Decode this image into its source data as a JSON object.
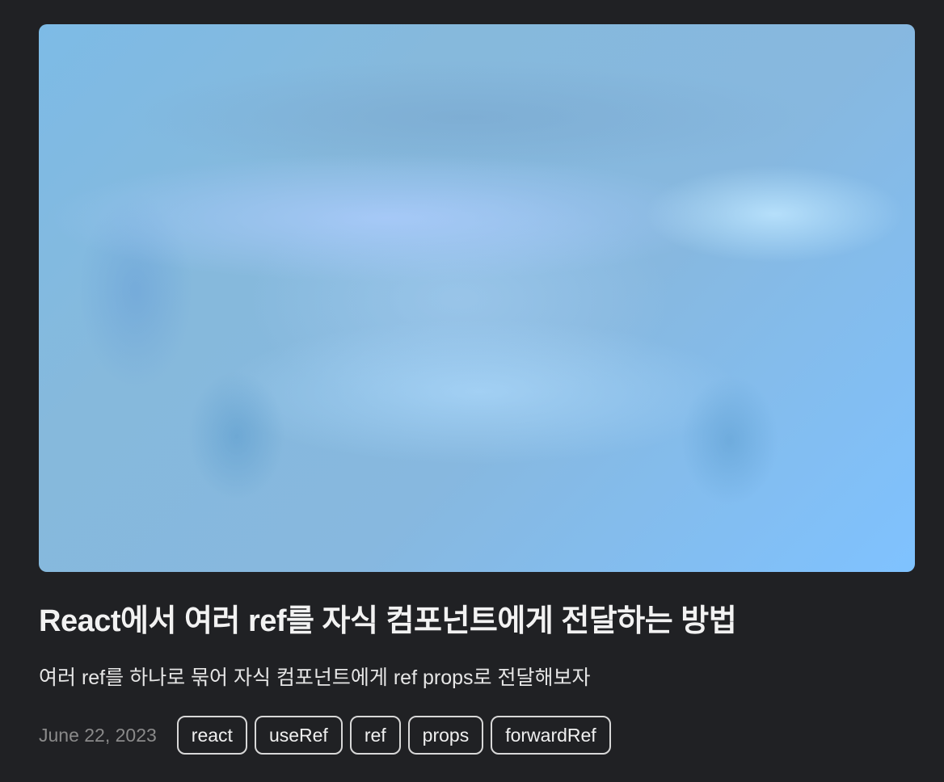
{
  "post": {
    "title": "React에서 여러 ref를 자식 컴포넌트에게 전달하는 방법",
    "description": "여러 ref를 하나로 묶어 자식 컴포넌트에게 ref props로 전달해보자",
    "date": "June 22, 2023",
    "tags": [
      "react",
      "useRef",
      "ref",
      "props",
      "forwardRef"
    ]
  }
}
